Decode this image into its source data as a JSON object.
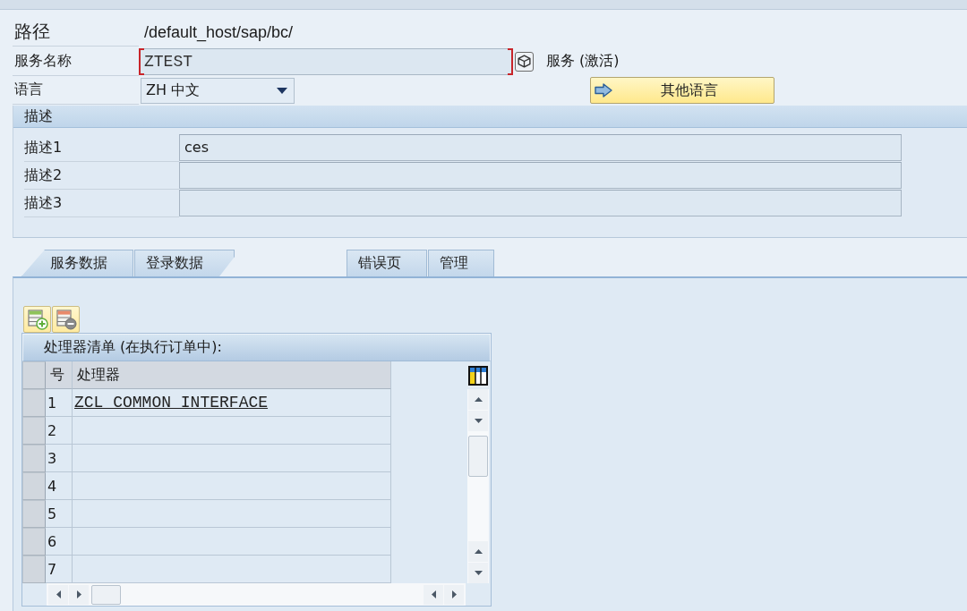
{
  "header": {
    "path": {
      "label": "路径",
      "value": "/default_host/sap/bc/"
    },
    "service_name": {
      "label": "服务名称",
      "value": "ZTEST",
      "status": "服务 (激活)"
    },
    "language": {
      "label": "语言",
      "value": "ZH 中文"
    },
    "other_languages_button": {
      "label": "其他语言"
    }
  },
  "description": {
    "title": "描述",
    "rows": [
      {
        "label": "描述1",
        "value": "ces"
      },
      {
        "label": "描述2"
      },
      {
        "label": "描述3"
      }
    ]
  },
  "tabs": [
    {
      "label": "服务数据",
      "selected": false
    },
    {
      "label": "登录数据",
      "selected": false
    },
    {
      "label": "错误页",
      "selected": false
    },
    {
      "label": "管理",
      "selected": false
    }
  ],
  "handler_list": {
    "title": "处理器清单 (在执行订单中):",
    "columns": [
      "号",
      "处理器"
    ],
    "rows": [
      {
        "number": "1",
        "handler": "ZCL_COMMON_INTERFACE"
      },
      {
        "number": "2"
      },
      {
        "number": "3"
      },
      {
        "number": "4"
      },
      {
        "number": "5"
      },
      {
        "number": "6"
      },
      {
        "number": "7"
      }
    ]
  }
}
